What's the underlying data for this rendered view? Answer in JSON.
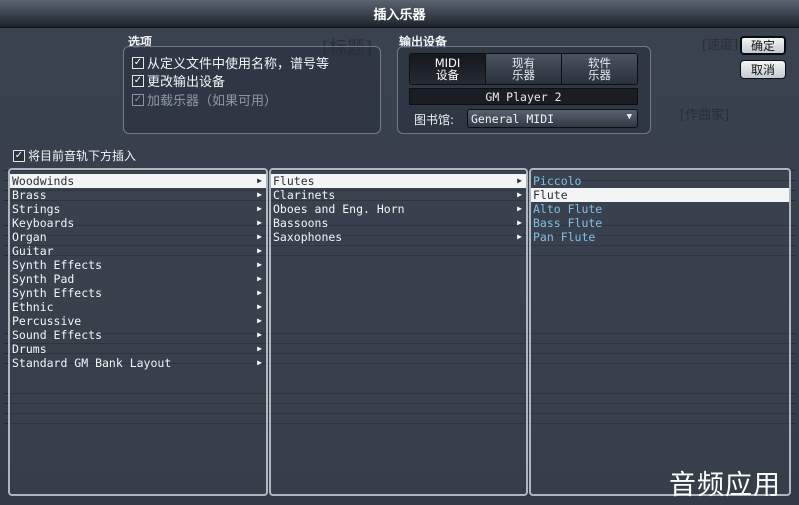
{
  "window": {
    "title": "插入乐器"
  },
  "background": {
    "title_text": "[标题]",
    "tempo_text": "[速度]",
    "composer_text": "[作曲家]"
  },
  "options": {
    "label": "选项",
    "use_names": {
      "label": "从定义文件中使用名称，谱号等",
      "checked": true
    },
    "change_output": {
      "label": "更改输出设备",
      "checked": true
    },
    "load_instruments": {
      "label": "加载乐器（如果可用）",
      "checked": true,
      "enabled": false
    }
  },
  "output": {
    "label": "输出设备",
    "tabs": [
      {
        "label": "MIDI\n设备",
        "active": true
      },
      {
        "label": "现有\n乐器",
        "active": false
      },
      {
        "label": "软件\n乐器",
        "active": false
      }
    ],
    "device": "GM Player 2",
    "library_label": "图书馆:",
    "library_value": "General MIDI"
  },
  "buttons": {
    "ok": "确定",
    "cancel": "取消"
  },
  "insert_below": {
    "label": "将目前音轨下方插入",
    "checked": true
  },
  "columns": {
    "families": [
      {
        "label": "Woodwinds",
        "selected": true
      },
      {
        "label": "Brass"
      },
      {
        "label": "Strings"
      },
      {
        "label": "Keyboards"
      },
      {
        "label": "Organ"
      },
      {
        "label": "Guitar"
      },
      {
        "label": "Synth Effects"
      },
      {
        "label": "Synth Pad"
      },
      {
        "label": "Synth Effects"
      },
      {
        "label": "Ethnic"
      },
      {
        "label": "Percussive"
      },
      {
        "label": "Sound Effects"
      },
      {
        "label": "Drums"
      },
      {
        "label": "Standard GM Bank Layout"
      }
    ],
    "groups": [
      {
        "label": "Flutes",
        "selected": true
      },
      {
        "label": "Clarinets"
      },
      {
        "label": "Oboes and Eng. Horn"
      },
      {
        "label": "Bassoons"
      },
      {
        "label": "Saxophones"
      }
    ],
    "instruments": [
      {
        "label": "Piccolo"
      },
      {
        "label": "Flute",
        "selected": true
      },
      {
        "label": "Alto Flute"
      },
      {
        "label": "Bass Flute"
      },
      {
        "label": "Pan Flute"
      }
    ]
  },
  "watermark": "音频应用",
  "colors": {
    "leaf_text": "#7fc0e6",
    "selection": "#f2f4f6"
  },
  "icons": {
    "submenu": "submenu-arrow-icon",
    "dropdown": "dropdown-arrow-icon",
    "checkbox": "checkbox-icon"
  }
}
